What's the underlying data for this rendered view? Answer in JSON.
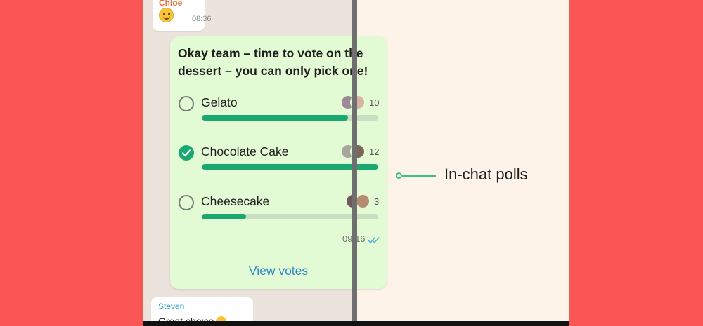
{
  "chat": {
    "chloe": {
      "sender": "Chloe",
      "time": "08:36",
      "emoji_icon": "grinning-face-emoji"
    },
    "steven": {
      "sender": "Steven",
      "text": "Great choice",
      "emoji_icon": "party-face-emoji"
    }
  },
  "poll": {
    "question": "Okay team – time to vote on the dessert – you can only pick one!",
    "options": [
      {
        "label": "Gelato",
        "votes": "10",
        "fill": 0.83,
        "selected": false
      },
      {
        "label": "Chocolate Cake",
        "votes": "12",
        "fill": 1.0,
        "selected": true
      },
      {
        "label": "Cheesecake",
        "votes": "3",
        "fill": 0.25,
        "selected": false
      }
    ],
    "time": "09:16",
    "status_icon": "double-check-read-icon",
    "view_votes_label": "View votes"
  },
  "callout": {
    "label": "In-chat polls"
  },
  "colors": {
    "background": "#fb5656",
    "panel": "#fdf3e8",
    "poll_bubble": "#e3fbd5",
    "accent_green": "#1aa772",
    "link_blue": "#2f86c8",
    "sender_orange": "#e8703c",
    "sender_blue": "#2fa3d6"
  }
}
